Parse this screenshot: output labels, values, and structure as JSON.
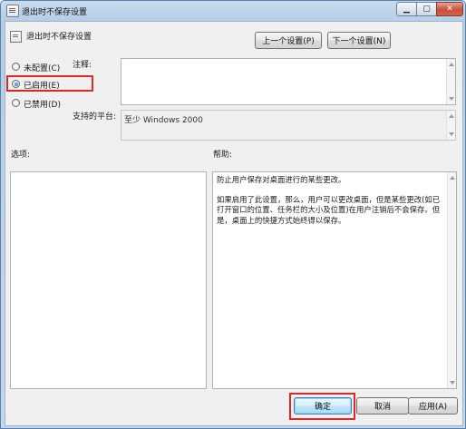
{
  "window": {
    "title": "退出时不保存设置"
  },
  "header": {
    "policy_name": "退出时不保存设置",
    "prev_setting_label": "上一个设置(P)",
    "next_setting_label": "下一个设置(N)"
  },
  "state": {
    "not_configured_label": "未配置(C)",
    "enabled_label": "已启用(E)",
    "disabled_label": "已禁用(D)",
    "selected": "enabled"
  },
  "comment": {
    "label": "注释:",
    "value": ""
  },
  "platform": {
    "label": "支持的平台:",
    "value": "至少 Windows 2000"
  },
  "options": {
    "label": "选项:"
  },
  "help": {
    "label": "帮助:",
    "paragraph1": "防止用户保存对桌面进行的某些更改。",
    "paragraph2": "如果启用了此设置，那么，用户可以更改桌面，但是某些更改(如已打开窗口的位置、任务栏的大小及位置)在用户注销后不会保存。但是，桌面上的快捷方式始终得以保存。"
  },
  "footer": {
    "ok_label": "确定",
    "cancel_label": "取消",
    "apply_label": "应用(A)"
  },
  "colors": {
    "highlight": "#e0262b",
    "title_bar": "#b6cde6",
    "close_button": "#c8503b"
  }
}
